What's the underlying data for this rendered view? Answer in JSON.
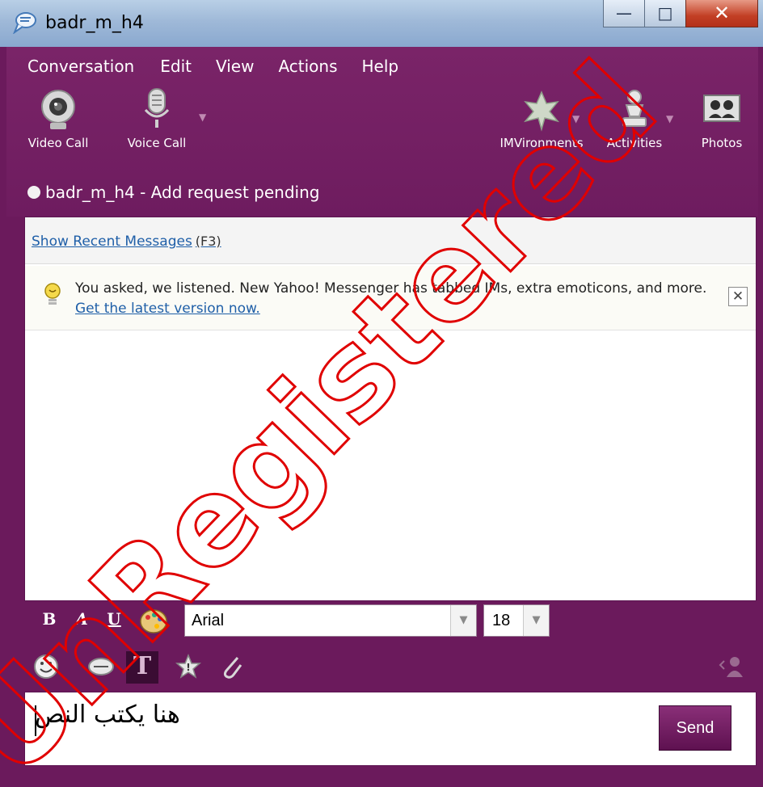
{
  "window": {
    "title": "badr_m_h4",
    "controls": {
      "minimize": "minimize",
      "maximize": "maximize",
      "close": "close"
    }
  },
  "menu": [
    "Conversation",
    "Edit",
    "View",
    "Actions",
    "Help"
  ],
  "toolbar": {
    "left": [
      {
        "label": "Video Call",
        "icon": "webcam-icon"
      },
      {
        "label": "Voice Call",
        "icon": "microphone-icon"
      }
    ],
    "right": [
      {
        "label": "IMVironments",
        "icon": "imvironments-icon"
      },
      {
        "label": "Activities",
        "icon": "activities-icon"
      },
      {
        "label": "Photos",
        "icon": "photos-icon"
      }
    ]
  },
  "status": {
    "text": "badr_m_h4 - Add request pending"
  },
  "messages": {
    "recent_link": "Show Recent Messages",
    "recent_shortcut": "(F3)",
    "notice_text": "You asked, we listened. New Yahoo! Messenger has tabbed IMs, extra emoticons, and more.",
    "notice_link": "Get the latest version now."
  },
  "format": {
    "bold": "B",
    "italic": "A",
    "underline": "U",
    "font": "Arial",
    "size": "18"
  },
  "input": {
    "text": "هنا يكتب النص",
    "send_label": "Send"
  },
  "watermark": {
    "text": "UnRegistered"
  },
  "colors": {
    "chrome": "#6b1a5c",
    "watermark": "#e00000",
    "link": "#1f5fa8"
  }
}
